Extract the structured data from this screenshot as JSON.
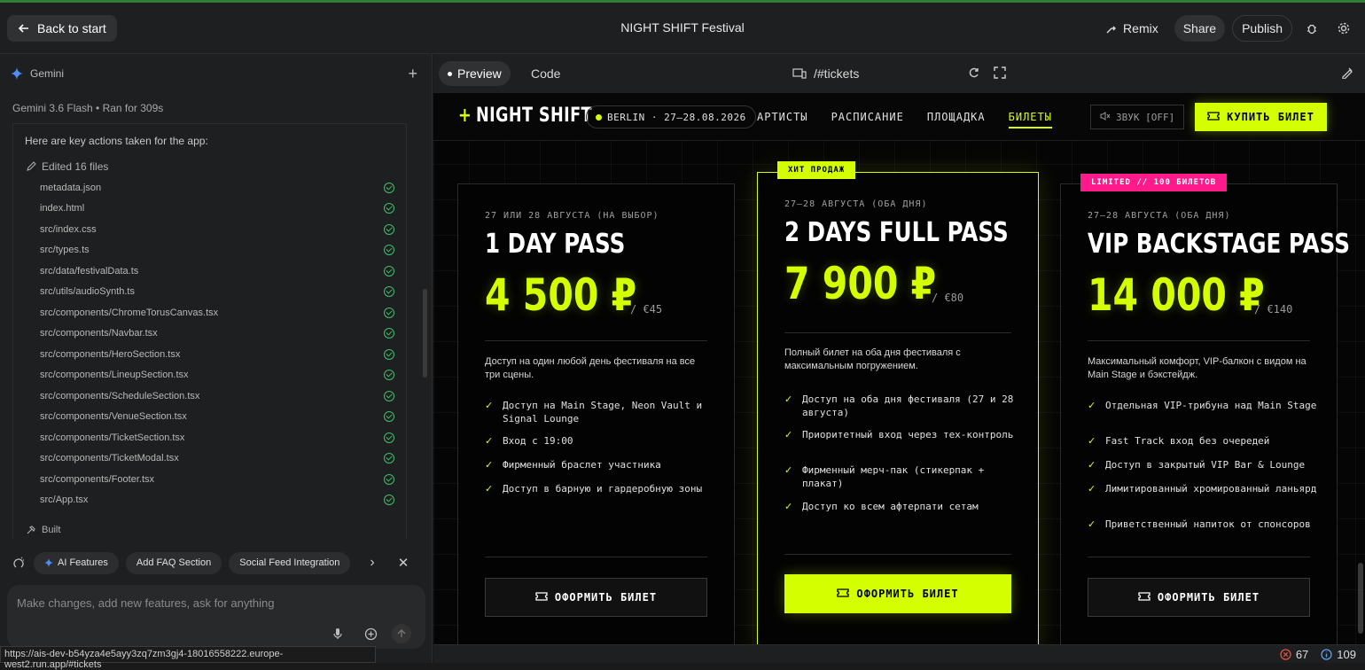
{
  "topbar": {
    "back_label": "Back to start",
    "title": "NIGHT SHIFT Festival",
    "remix_label": "Remix",
    "share_label": "Share",
    "publish_label": "Publish"
  },
  "left": {
    "assistant_name": "Gemini",
    "model_line": "Gemini 3.6 Flash  •  Ran for 309s",
    "intro": "Here are key actions taken for the app:",
    "edited_label": "Edited 16 files",
    "files": [
      "metadata.json",
      "index.html",
      "src/index.css",
      "src/types.ts",
      "src/data/festivalData.ts",
      "src/utils/audioSynth.ts",
      "src/components/ChromeTorusCanvas.tsx",
      "src/components/Navbar.tsx",
      "src/components/HeroSection.tsx",
      "src/components/LineupSection.tsx",
      "src/components/ScheduleSection.tsx",
      "src/components/VenueSection.tsx",
      "src/components/TicketSection.tsx",
      "src/components/TicketModal.tsx",
      "src/components/Footer.tsx",
      "src/App.tsx"
    ],
    "built_label": "Built",
    "chips": [
      "AI Features",
      "Add FAQ Section",
      "Social Feed Integration"
    ],
    "input_placeholder": "Make changes, add new features, ask for anything",
    "status_url": "https://ais-dev-b54yza4e5ayy3zq7zm3gj4-18016558222.europe-west2.run.app/#tickets"
  },
  "preview": {
    "tab_preview": "Preview",
    "tab_code": "Code",
    "url": "/#tickets"
  },
  "site": {
    "logo": "NIGHT SHIFT",
    "logo_plus": "+",
    "location": "BERLIN  ·  27–28.08.2026",
    "nav": [
      "АРТИСТЫ",
      "РАСПИСАНИЕ",
      "ПЛОЩАДКА",
      "БИЛЕТЫ"
    ],
    "sound": "ЗВУК [OFF]",
    "buy": "КУПИТЬ БИЛЕТ",
    "accent_color": "#d4ff00",
    "cards": [
      {
        "badge": "",
        "date": "27 ИЛИ 28 АВГУСТА (НА ВЫБОР)",
        "name": "1 DAY PASS",
        "price": "4 500 ₽",
        "eur": "/ €45",
        "desc": "Доступ на один любой день фестиваля на все три сцены.",
        "features": [
          "Доступ на Main Stage, Neon Vault и Signal Lounge",
          "Вход с 19:00",
          "Фирменный браслет участника",
          "Доступ в барную и гардеробную зоны"
        ],
        "button": "ОФОРМИТЬ БИЛЕТ"
      },
      {
        "badge": "ХИТ ПРОДАЖ",
        "date": "27–28 АВГУСТА (ОБА ДНЯ)",
        "name": "2 DAYS FULL PASS",
        "price": "7 900 ₽",
        "eur": "/ €80",
        "desc": "Полный билет на оба дня фестиваля с максимальным погружением.",
        "features": [
          "Доступ на оба дня фестиваля (27 и 28 августа)",
          "Приоритетный вход через тех-контроль",
          "Фирменный мерч-пак (стикерпак + плакат)",
          "Доступ ко всем афтерпати сетам"
        ],
        "button": "ОФОРМИТЬ БИЛЕТ"
      },
      {
        "badge": "LIMITED // 100 БИЛЕТОВ",
        "date": "27–28 АВГУСТА (ОБА ДНЯ)",
        "name": "VIP BACKSTAGE PASS",
        "price": "14 000 ₽",
        "eur": "/ €140",
        "desc": "Максимальный комфорт, VIP-балкон с видом на Main Stage и бэкстейдж.",
        "features": [
          "Отдельная VIP-трибуна над Main Stage",
          "Fast Track вход без очередей",
          "Доступ в закрытый VIP Bar & Lounge",
          "Лимитированный хромированный ланьярд",
          "Приветственный напиток от спонсоров"
        ],
        "button": "ОФОРМИТЬ БИЛЕТ"
      }
    ]
  },
  "status": {
    "errors": "67",
    "info": "109"
  }
}
